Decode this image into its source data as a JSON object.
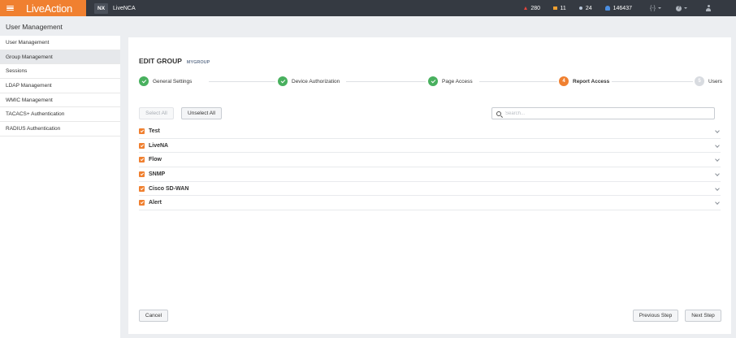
{
  "topbar": {
    "brand": "LiveAction",
    "badge": "NX",
    "product": "LiveNCA",
    "alerts": {
      "critical": "280",
      "warning": "11",
      "info": "24",
      "notifications": "146437"
    },
    "menu_button": "{-}"
  },
  "page_title": "User Management",
  "sidebar": {
    "items": [
      {
        "label": "User Management"
      },
      {
        "label": "Group Management"
      },
      {
        "label": "Sessions"
      },
      {
        "label": "LDAP Management"
      },
      {
        "label": "WMIC Management"
      },
      {
        "label": "TACACS+ Authentication"
      },
      {
        "label": "RADIUS Authentication"
      }
    ],
    "active_index": 1
  },
  "main": {
    "title": "EDIT GROUP",
    "subtitle": "MYGROUP",
    "steps": [
      {
        "label": "General Settings",
        "status": "done"
      },
      {
        "label": "Device Authorization",
        "status": "done"
      },
      {
        "label": "Page Access",
        "status": "done"
      },
      {
        "label": "Report Access",
        "status": "current",
        "number": "4"
      },
      {
        "label": "Users",
        "status": "pending",
        "number": "5"
      }
    ],
    "select_all": "Select All",
    "unselect_all": "Unselect All",
    "search_placeholder": "Search...",
    "reports": [
      {
        "label": "Test",
        "checked": true
      },
      {
        "label": "LiveNA",
        "checked": true
      },
      {
        "label": "Flow",
        "checked": true
      },
      {
        "label": "SNMP",
        "checked": true
      },
      {
        "label": "Cisco SD-WAN",
        "checked": true
      },
      {
        "label": "Alert",
        "checked": true
      }
    ],
    "cancel": "Cancel",
    "previous_step": "Previous Step",
    "next_step": "Next Step"
  },
  "colors": {
    "brand_orange": "#f08030",
    "topbar_bg": "#353a42",
    "done_green": "#48b05e",
    "pending_gray": "#d8dbe0"
  }
}
